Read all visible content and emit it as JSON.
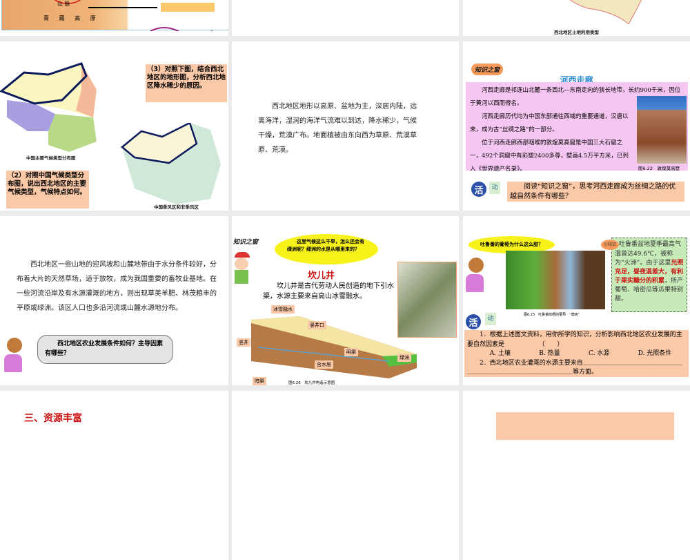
{
  "slides": [
    {
      "labels": {
        "mountain": "山 脉",
        "plateau": "青 藏 高 原"
      }
    },
    {},
    {
      "caption": "西北地区土地利用类型"
    },
    {
      "question3": "（3）对照下图，结合西北地区的地形图，分析西北地区降水稀少的原因。",
      "map1_caption": "中国主要气候类型分布图",
      "question2": "（2）对照中国气候类型分布图，说出西北地区的主要气候类型，气候特点如何。",
      "map2_caption": "中国季风区和非季风区"
    },
    {
      "body": "西北地区地形以高原、盆地为主，深居内陆，远离海洋，湿润的海洋气流难以到达，降水稀少，气候干燥，荒漠广布。地面植被由东向西为草原、荒漠草原、荒漠。"
    },
    {
      "badge": "知识之窗",
      "title": "河西走廊",
      "paras": [
        "河西走廊是祁连山北麓一条西北—东南走向的狭长地带，长约900千米，因位于黄河以西而得名。",
        "河西走廊历代均为中国东部通往西域的重要通道，汉唐以来，成为古“丝绸之路”的一部分。",
        "位于河西走廊西部咽喉的敦煌莫高窟是中国三大石窟之一，492个洞窟中有彩塑2400多尊，壁画4.5万平方米，已列入《世界遗产名录》。"
      ],
      "photo_caption": "图6.22　敦煌莫高窟",
      "activity_icon": "活",
      "activity_label": "动",
      "activity_text": "阅读“知识之窗”，思考河西走廊成为丝绸之路的优越自然条件有哪些？"
    },
    {
      "body": "西北地区一些山地的迎风坡和山麓地带由于水分条件较好，分布着大片的天然草场，适于放牧，成为我国重要的畜牧业基地。在一些河流沿岸及有水源灌溉的地方，则出现草美羊肥、林茂粮丰的平原或绿洲。该区人口也多沿河流或山麓水源地分布。",
      "bubble": "西北地区农业发展条件如何？主导因素有哪些？"
    },
    {
      "badge": "知识之窗",
      "bubble": "这里气候这么干旱，怎么还会有绿洲呢？绿洲的水是从哪里来的？",
      "title": "坎儿井",
      "body": "坎儿井是古代劳动人民创造的地下引水渠，水源主要来自高山冰雪融水。",
      "labels": {
        "snow": "冰雪融水",
        "shaft_mouth": "竖井口",
        "shaft": "竖井",
        "open_canal": "明渠",
        "oasis": "绿洲",
        "aquifer": "含水层",
        "hidden_canal": "暗渠"
      },
      "figure_caption": "图6.26　坎儿井构造示意图"
    },
    {
      "bubble": "吐鲁番的葡萄为什么这么甜？",
      "photo_caption": "图6.25　吐鲁番晾晒的葡萄　“荫房”",
      "tip_badge": "小知识",
      "tip_text_1": "吐鲁番盆地夏季最高气温曾达49.6℃，被称为“火洲”。由于这里",
      "tip_highlight": "光照充足，昼夜温差大，有利于果实糖分的积累",
      "tip_text_2": "，所产葡萄、哈密瓜等瓜果特别甜。",
      "activity_icon": "活",
      "activity_label": "动",
      "q1": "1．根据上述图文资料，用你所学的知识，分析影响西北地区农业发展的主要自然因素是　　　　　　（　　）",
      "options": [
        "A. 土壤",
        "B. 热量",
        "C. 水源",
        "D. 光照条件"
      ],
      "q2": "2．西北地区农业灌溉的水源主要来自＿＿＿＿＿＿＿＿＿＿＿＿＿＿＿＿＿＿＿＿＿＿＿＿＿＿＿＿＿＿＿＿＿等方面。"
    },
    {
      "heading": "三、资源丰富"
    },
    {},
    {}
  ],
  "colors": {
    "gap": "#ebebeb",
    "peach": "#fbc9a8",
    "pink": "#f6c6f2",
    "title_blue": "#2a8ad0",
    "red": "#cc1111"
  }
}
